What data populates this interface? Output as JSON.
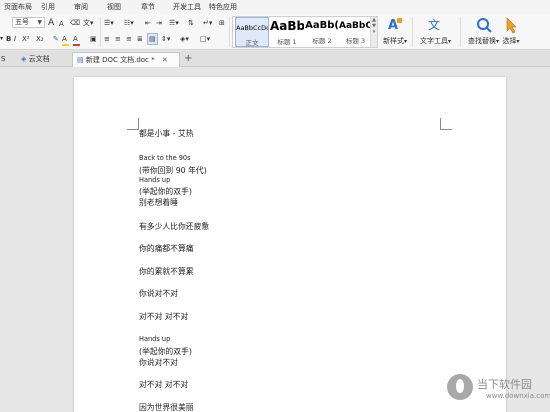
{
  "menu": {
    "items": [
      "页面布局",
      "引用",
      "审阅",
      "视图",
      "章节",
      "开发工具",
      "特色应用"
    ]
  },
  "ribbon": {
    "font_size_value": "五号",
    "grow_font": "A",
    "shrink_font": "A",
    "bold": "B",
    "italic": "I",
    "superscript": "X²",
    "subscript": "X₂",
    "font_color": "A",
    "highlight": "A",
    "styles": [
      {
        "preview": "AaBbCcDd",
        "caption": "正文",
        "selected": true
      },
      {
        "preview": "AaBb",
        "caption": "标题 1",
        "selected": false
      },
      {
        "preview": "AaBb(",
        "caption": "标题 2",
        "selected": false
      },
      {
        "preview": "AaBbC",
        "caption": "标题 3",
        "selected": false
      }
    ],
    "new_style": "新样式",
    "text_tools": "文字工具",
    "find_replace": "查找替换",
    "select": "选择"
  },
  "tabs": [
    {
      "label": "S",
      "active": false
    },
    {
      "label": "云文档",
      "active": false
    },
    {
      "label": "新建 DOC 文档.doc *",
      "active": true
    }
  ],
  "new_tab": "+",
  "document": {
    "lines": [
      {
        "text": "都是小事 - 艾热",
        "style": "cn"
      },
      {
        "text": "Back to the 90s",
        "style": "en"
      },
      {
        "text": "(带你回到 90 年代)",
        "style": "cn"
      },
      {
        "text": "Hands up",
        "style": "en"
      },
      {
        "text": "(举起你的双手)",
        "style": "cn"
      },
      {
        "text": "别老想着睡",
        "style": "cn"
      },
      {
        "text": "有多少人比你还疲惫",
        "style": "cn"
      },
      {
        "text": "你的痛都不算痛",
        "style": "cn"
      },
      {
        "text": "你的累就不算累",
        "style": "cn"
      },
      {
        "text": "你说对不对",
        "style": "cn"
      },
      {
        "text": "对不对  对不对",
        "style": "cn"
      },
      {
        "text": "Hands up",
        "style": "en"
      },
      {
        "text": "(举起你的双手)",
        "style": "cn"
      },
      {
        "text": "你说对不对",
        "style": "cn"
      },
      {
        "text": "对不对  对不对",
        "style": "cn"
      },
      {
        "text": "因为世界很美丽",
        "style": "cn"
      }
    ]
  },
  "watermark": {
    "title": "当下软件园",
    "url": "www.downxia.com"
  },
  "colors": {
    "accent": "#2b6fd6",
    "font_color_bar": "#e23a2e",
    "highlight_bar": "#f5d31a",
    "page": "#ffffff",
    "workspace": "#e6e6e6"
  }
}
